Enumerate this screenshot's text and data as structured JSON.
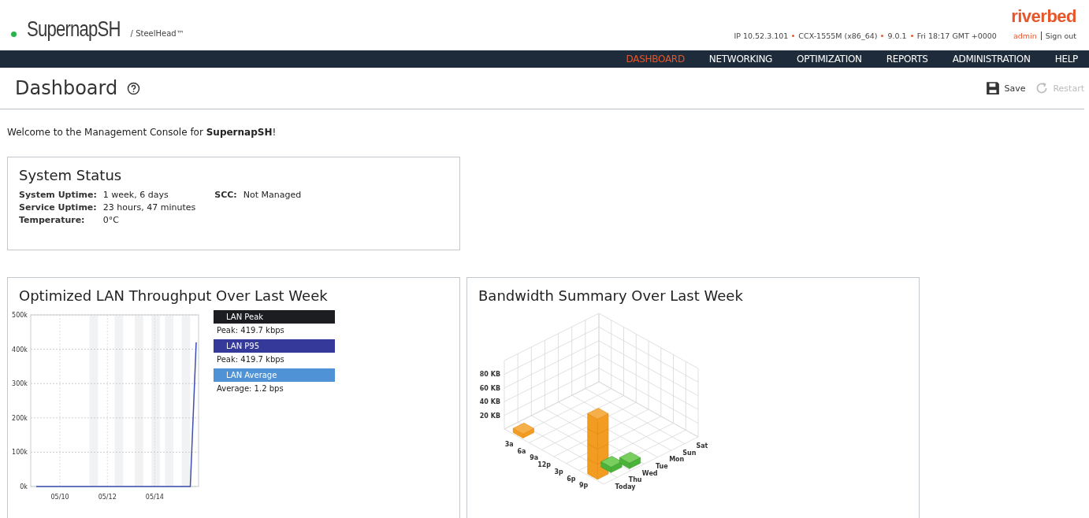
{
  "header": {
    "product": "SupernapSH",
    "subtitle": "/ SteelHead™",
    "brand": "riverbed",
    "info": [
      "IP 10.52.3.101",
      "CCX-1555M (x86_64)",
      "9.0.1",
      "Fri 18:17 GMT +0000"
    ],
    "user": "admin",
    "sign_out": "Sign out"
  },
  "nav": [
    {
      "label": "DASHBOARD",
      "selected": true
    },
    {
      "label": "NETWORKING",
      "selected": false
    },
    {
      "label": "OPTIMIZATION",
      "selected": false
    },
    {
      "label": "REPORTS",
      "selected": false
    },
    {
      "label": "ADMINISTRATION",
      "selected": false
    },
    {
      "label": "HELP",
      "selected": false
    }
  ],
  "page": {
    "title": "Dashboard",
    "actions": [
      {
        "kind": "save",
        "label": "Save",
        "disabled": false
      },
      {
        "kind": "restart",
        "label": "Restart",
        "disabled": true
      }
    ]
  },
  "welcome": "Welcome to the Management Console for **SupernapSH**!",
  "system_status": {
    "title": "System Status",
    "items": [
      {
        "label": "System Uptime:",
        "value": "1 week, 6 days"
      },
      {
        "label": "Service Uptime:",
        "value": "23 hours, 47 minutes"
      },
      {
        "label": "Temperature:",
        "value": "0°C"
      }
    ],
    "side_items": [
      {
        "label": "SCC:",
        "value": "Not Managed"
      }
    ]
  },
  "throughput": {
    "title": "Optimized LAN Throughput Over Last Week",
    "chart_data": {
      "type": "line",
      "grid": true,
      "categories": [
        null,
        null,
        null,
        null,
        "05/10",
        null,
        null,
        null,
        null,
        null,
        null,
        null,
        "05/12",
        null,
        null,
        null,
        null,
        null,
        null,
        null,
        "05/14",
        null,
        null,
        null,
        null,
        null,
        null,
        null
      ],
      "series": [
        {
          "color": "#3f4fb0",
          "values": [
            0,
            0,
            0,
            0,
            0,
            0,
            0,
            0,
            0,
            0,
            0,
            0,
            0,
            0,
            0,
            0,
            0,
            0,
            0,
            0,
            0,
            0,
            0,
            0,
            0,
            0,
            0,
            420000
          ]
        }
      ],
      "ylim": [
        0,
        500000
      ],
      "yticks": [
        {
          "value": 0,
          "label": "0k"
        },
        {
          "value": 100000,
          "label": "100k"
        },
        {
          "value": 200000,
          "label": "200k"
        },
        {
          "value": 300000,
          "label": "300k"
        },
        {
          "value": 400000,
          "label": "400k"
        },
        {
          "value": 500000,
          "label": "500k"
        }
      ]
    },
    "legend": [
      {
        "label": "LAN Peak",
        "color": "#1b1d20",
        "detail": "Peak: 419.7 kbps"
      },
      {
        "label": "LAN P95",
        "color": "#35399a",
        "detail": "Peak: 419.7 kbps"
      },
      {
        "label": "LAN Average",
        "color": "#4f92d6",
        "detail": "Average: 1.2 bps"
      }
    ]
  },
  "bandwidth": {
    "title": "Bandwidth Summary Over Last Week",
    "y_labels": [
      "80 KB",
      "60 KB",
      "40 KB",
      "20 KB"
    ],
    "hour_labels": [
      "3a",
      "6a",
      "9a",
      "12p",
      "3p",
      "6p",
      "9p"
    ],
    "day_labels": [
      "Today",
      "Thu",
      "Wed",
      "Tue",
      "Mon",
      "Sun",
      "Sat"
    ]
  }
}
